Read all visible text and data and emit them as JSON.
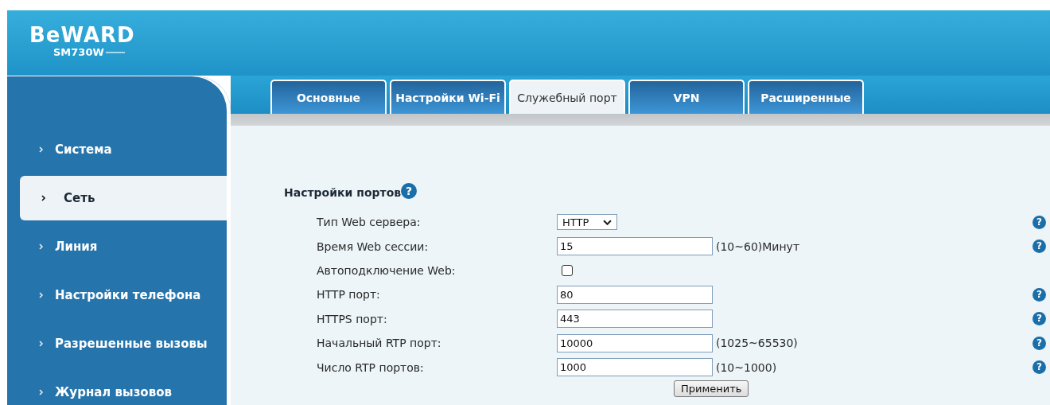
{
  "header": {
    "logo": "BeWARD",
    "model": "SM730W"
  },
  "sidebar": {
    "items": [
      {
        "label": "Система",
        "selected": false
      },
      {
        "label": "Сеть",
        "selected": true
      },
      {
        "label": "Линия",
        "selected": false
      },
      {
        "label": "Настройки телефона",
        "selected": false
      },
      {
        "label": "Разрешенные вызовы",
        "selected": false
      },
      {
        "label": "Журнал вызовов",
        "selected": false
      }
    ]
  },
  "tabs": [
    {
      "label": "Основные",
      "selected": false
    },
    {
      "label": "Настройки Wi-Fi",
      "selected": false
    },
    {
      "label": "Служебный порт",
      "selected": true
    },
    {
      "label": "VPN",
      "selected": false
    },
    {
      "label": "Расширенные",
      "selected": false
    }
  ],
  "section": {
    "title": "Настройки портов",
    "help": "?"
  },
  "fields": [
    {
      "kind": "select",
      "label": "Тип Web сервера:",
      "value": "HTTP",
      "help": "?"
    },
    {
      "kind": "text",
      "label": "Время Web сессии:",
      "value": "15",
      "hint": "(10~60)Минут",
      "help": "?"
    },
    {
      "kind": "checkbox",
      "label": "Автоподключение Web:",
      "checked": false
    },
    {
      "kind": "text",
      "label": "HTTP порт:",
      "value": "80",
      "help": "?"
    },
    {
      "kind": "text",
      "label": "HTTPS порт:",
      "value": "443",
      "help": "?"
    },
    {
      "kind": "text",
      "label": "Начальный RTP порт:",
      "value": "10000",
      "hint": "(1025~65530)",
      "help": "?"
    },
    {
      "kind": "text",
      "label": "Число RTP портов:",
      "value": "1000",
      "hint": "(10~1000)",
      "help": "?"
    }
  ],
  "apply_button": "Применить"
}
